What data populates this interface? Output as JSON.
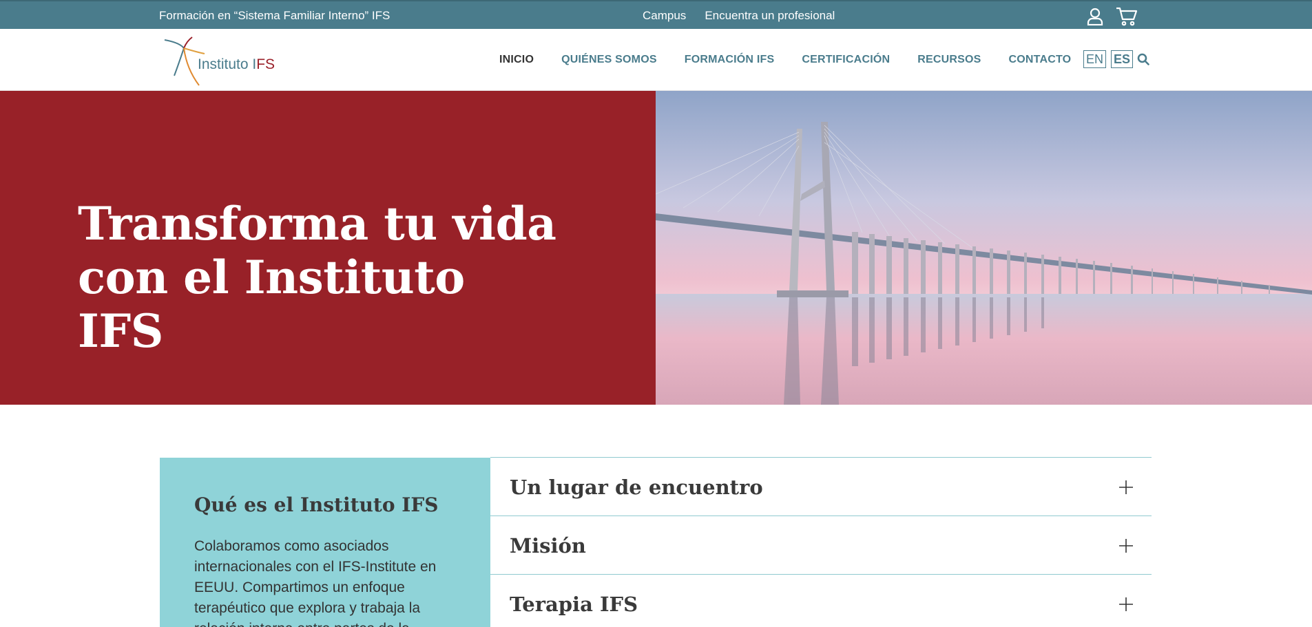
{
  "topbar": {
    "tagline": "Formación en “Sistema Familiar Interno” IFS",
    "links": [
      "Campus",
      "Encuentra un profesional"
    ],
    "icons": [
      "user-icon",
      "cart-icon"
    ]
  },
  "logo": {
    "text_prefix": "Instituto I",
    "text_brand": "FS"
  },
  "nav": {
    "items": [
      "INICIO",
      "QUIÉNES SOMOS",
      "FORMACIÓN IFS",
      "CERTIFICACIÓN",
      "RECURSOS",
      "CONTACTO"
    ],
    "active": "INICIO"
  },
  "lang": {
    "options": [
      "EN",
      "ES"
    ],
    "active": "ES"
  },
  "hero": {
    "title_line1": "Transforma tu vida",
    "title_line2": "con el Instituto IFS"
  },
  "about": {
    "title": "Qué es el Instituto IFS",
    "body": "Colaboramos como  asociados internacionales con el IFS-Institute en EEUU. Compartimos un enfoque terapéutico que explora y trabaja la relación interna entre partes de la"
  },
  "accordion": {
    "items": [
      "Un lugar de encuentro",
      "Misión",
      "Terapia IFS"
    ]
  },
  "colors": {
    "topbar": "#4a7c8c",
    "hero_red": "#982128",
    "about_teal": "#8fd3d8",
    "nav_text": "#4a7c8c"
  }
}
